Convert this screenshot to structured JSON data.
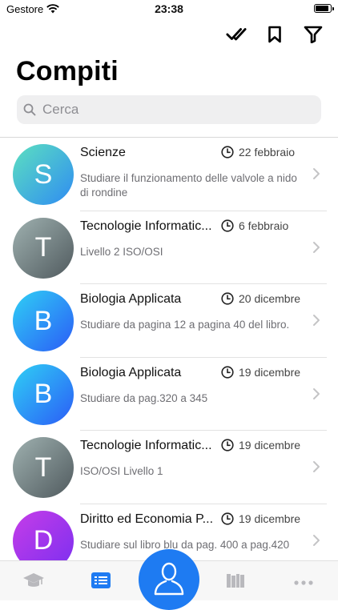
{
  "status": {
    "carrier": "Gestore",
    "time": "23:38"
  },
  "header": {
    "title": "Compiti"
  },
  "search": {
    "placeholder": "Cerca"
  },
  "toolbar": {
    "icons": [
      "checkmark-double-icon",
      "bookmark-icon",
      "filter-icon"
    ]
  },
  "colors": {
    "accent": "#1e7bf2",
    "chevron": "#c4c4c6",
    "secondary_text": "#6e6e73"
  },
  "homework": [
    {
      "initial": "S",
      "subject": "Scienze",
      "date": "22 febbraio",
      "description": "Studiare il funzionamento delle valvole a nido di rondine",
      "gradient": [
        "#5ce0c0",
        "#2f8cf2"
      ]
    },
    {
      "initial": "T",
      "subject": "Tecnologie Informatic...",
      "date": "6 febbraio",
      "description": "Livello 2 ISO/OSI",
      "gradient": [
        "#9fb1b0",
        "#505a5e"
      ]
    },
    {
      "initial": "B",
      "subject": "Biologia Applicata",
      "date": "20 dicembre",
      "description": "Studiare da pagina 12 a pagina 40 del libro.",
      "gradient": [
        "#2fd0f5",
        "#2b5cf6"
      ]
    },
    {
      "initial": "B",
      "subject": "Biologia Applicata",
      "date": "19 dicembre",
      "description": "Studiare da pag.320 a 345",
      "gradient": [
        "#2fd0f5",
        "#2b5cf6"
      ]
    },
    {
      "initial": "T",
      "subject": "Tecnologie Informatic...",
      "date": "19 dicembre",
      "description": "ISO/OSI Livello 1",
      "gradient": [
        "#9fb1b0",
        "#505a5e"
      ]
    },
    {
      "initial": "D",
      "subject": "Diritto ed Economia P...",
      "date": "19 dicembre",
      "description": "Studiare sul libro blu da pag. 400 a pag.420",
      "gradient": [
        "#c63de8",
        "#7b2ff0"
      ]
    }
  ],
  "tabs": [
    {
      "icon": "graduation-cap-icon",
      "active": false
    },
    {
      "icon": "list-icon",
      "active": true
    },
    {
      "icon": "user-icon",
      "active": false
    },
    {
      "icon": "books-icon",
      "active": false
    },
    {
      "icon": "more-icon",
      "active": false
    }
  ]
}
